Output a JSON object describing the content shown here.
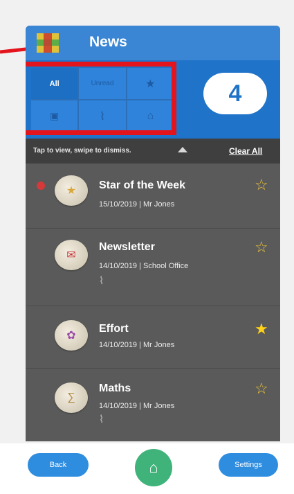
{
  "header": {
    "title": "News"
  },
  "filters": {
    "cells": [
      {
        "label": "All",
        "icon": "",
        "active": true
      },
      {
        "label": "Unread",
        "icon": "",
        "active": false
      },
      {
        "label": "",
        "icon": "★",
        "active": false
      },
      {
        "label": "",
        "icon": "▣",
        "active": false
      },
      {
        "label": "",
        "icon": "⌇",
        "active": false
      },
      {
        "label": "",
        "icon": "⌂",
        "active": false
      }
    ]
  },
  "badge": {
    "count": "4"
  },
  "toolbar": {
    "hint": "Tap to view, swipe to dismiss.",
    "clear_all": "Clear All"
  },
  "items": [
    {
      "title": "Star of the Week",
      "meta": "15/10/2019 | Mr Jones",
      "starred": false,
      "unread": true,
      "attachment": false,
      "avatar_icon": "★"
    },
    {
      "title": "Newsletter",
      "meta": "14/10/2019 | School Office",
      "starred": false,
      "unread": false,
      "attachment": true,
      "avatar_icon": "✉"
    },
    {
      "title": "Effort",
      "meta": "14/10/2019 | Mr Jones",
      "starred": true,
      "unread": false,
      "attachment": false,
      "avatar_icon": "✿"
    },
    {
      "title": "Maths",
      "meta": "14/10/2019 | Mr Jones",
      "starred": false,
      "unread": false,
      "attachment": true,
      "avatar_icon": "∑"
    }
  ],
  "bottom": {
    "back": "Back",
    "settings": "Settings",
    "home_icon": "⌂"
  },
  "colors": {
    "brand": "#3a86d4",
    "accent_red": "#e4141c",
    "home_green": "#3fb37a",
    "star": "#ffd11a"
  }
}
